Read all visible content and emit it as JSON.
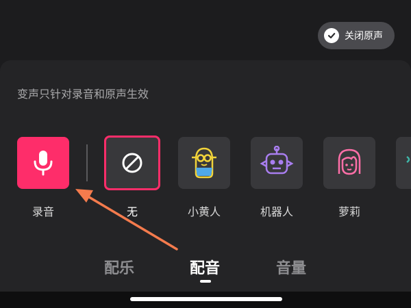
{
  "toggle": {
    "label": "关闭原声",
    "icon": "checkmark-icon"
  },
  "hint_text": "变声只针对录音和原声生效",
  "effects": [
    {
      "label": "录音",
      "icon": "microphone-icon"
    },
    {
      "label": "无",
      "icon": "prohibit-icon",
      "selected": true
    },
    {
      "label": "小黄人",
      "icon": "minion-icon"
    },
    {
      "label": "机器人",
      "icon": "robot-icon"
    },
    {
      "label": "萝莉",
      "icon": "girl-face-icon"
    }
  ],
  "tabs": [
    {
      "label": "配乐"
    },
    {
      "label": "配音",
      "active": true
    },
    {
      "label": "音量"
    }
  ],
  "colors": {
    "accent": "#fe2d6a",
    "arrow": "#f47b4d",
    "minion": "#f2d43a",
    "robot": "#a97ef0",
    "girl": "#ff6fa8"
  }
}
